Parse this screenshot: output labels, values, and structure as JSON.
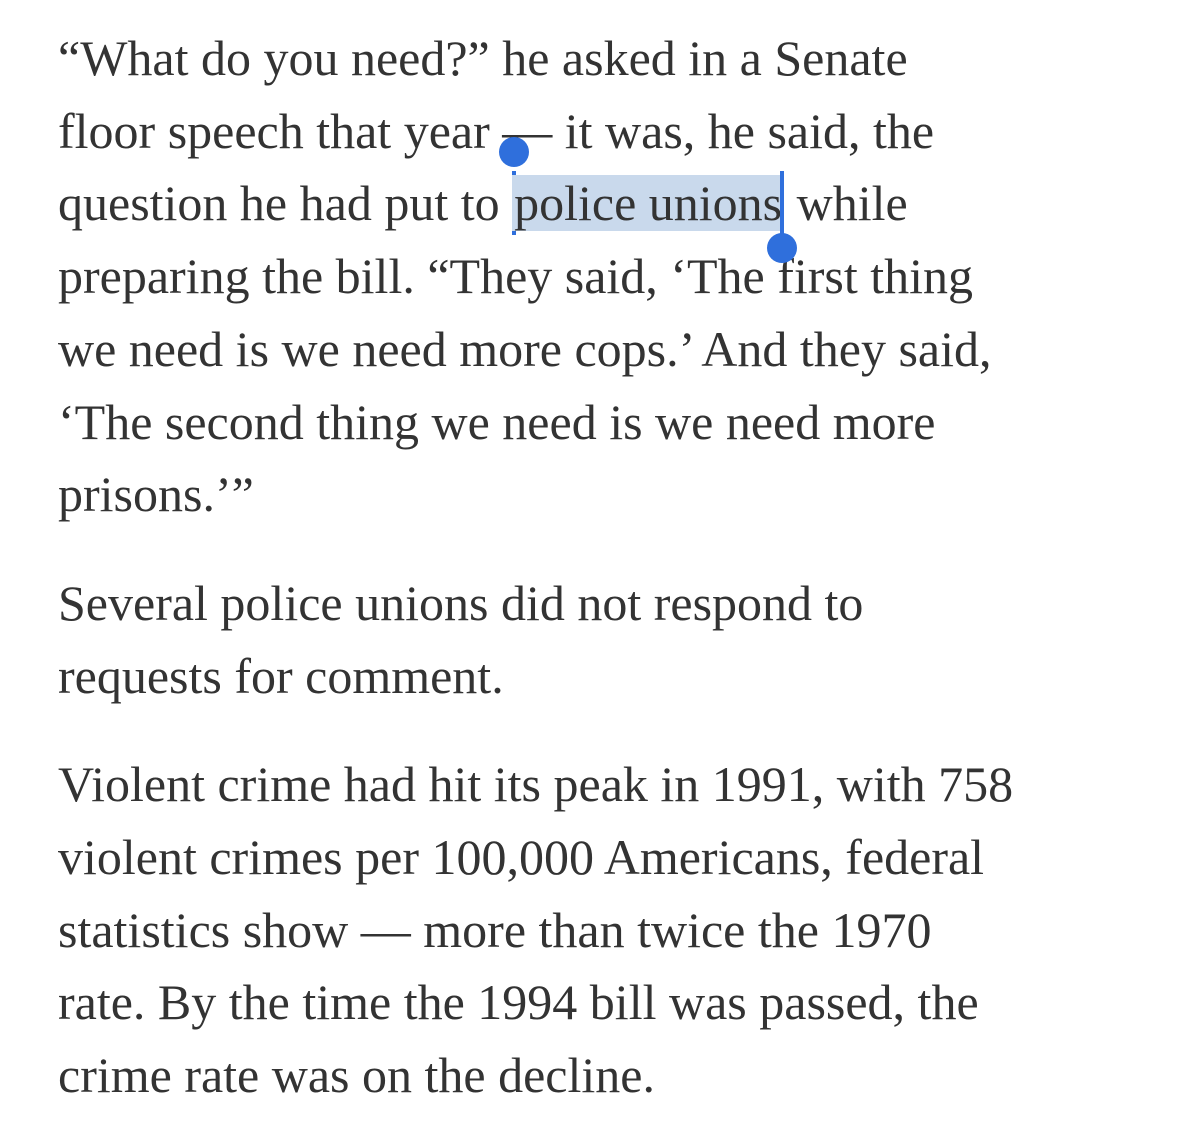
{
  "article": {
    "paragraphs": [
      {
        "lines": [
          "“What do you need?” he asked in a Senate",
          "floor speech that year — it was, he said, the"
        ],
        "selection_line": {
          "before": "question he had put to ",
          "selected": "police unions",
          "after": " while"
        },
        "lines_after": [
          "preparing the bill. “They said, ‘The first thing",
          "we need is we need more cops.’ And they said,",
          "‘The second thing we need is we need more",
          "prisons.’”"
        ]
      },
      {
        "lines": [
          "Several police unions did not respond to",
          "requests for comment."
        ]
      },
      {
        "lines": [
          "Violent crime had hit its peak in 1991, with 758",
          "violent crimes per 100,000 Americans, federal",
          "statistics show — more than twice the 1970",
          "rate. By the time the 1994 bill was passed, the",
          "crime rate was on the decline."
        ]
      }
    ]
  },
  "colors": {
    "text": "#333333",
    "selection": "#c9d9ec",
    "handle": "#2f6fdc"
  }
}
